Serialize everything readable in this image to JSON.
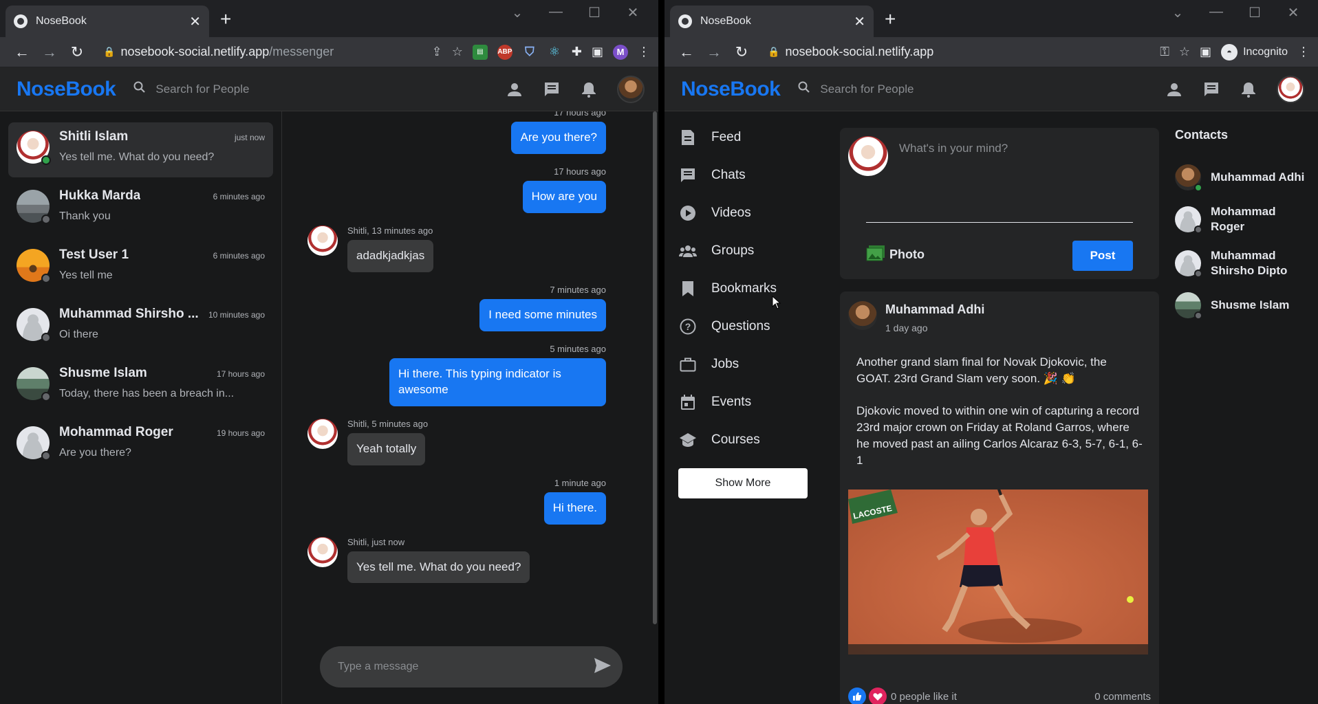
{
  "left_window": {
    "tab_title": "NoseBook",
    "url_host": "nosebook-social.netlify.app",
    "url_path": "/messenger",
    "app": {
      "logo": "NoseBook",
      "search_placeholder": "Search for People"
    },
    "conversations": [
      {
        "name": "Shitli Islam",
        "time": "just now",
        "last": "Yes tell me. What do you need?",
        "online": true,
        "active": true,
        "avatar": "hijab-portrait"
      },
      {
        "name": "Hukka Marda",
        "time": "6 minutes ago",
        "last": "Thank you",
        "online": false,
        "active": false,
        "avatar": "building-photo"
      },
      {
        "name": "Test User 1",
        "time": "6 minutes ago",
        "last": "Yes tell me",
        "online": false,
        "active": false,
        "avatar": "desert-camel"
      },
      {
        "name": "Muhammad Shirsho ...",
        "time": "10 minutes ago",
        "last": "Oi there",
        "online": false,
        "active": false,
        "avatar": "default-user"
      },
      {
        "name": "Shusme Islam",
        "time": "17 hours ago",
        "last": "Today, there has been a breach in...",
        "online": false,
        "active": false,
        "avatar": "landscape-photo"
      },
      {
        "name": "Mohammad Roger",
        "time": "19 hours ago",
        "last": "Are you there?",
        "online": false,
        "active": false,
        "avatar": "default-user"
      }
    ],
    "messages": [
      {
        "mine": true,
        "meta": "17 hours ago",
        "text": "Are you there?"
      },
      {
        "mine": true,
        "meta": "17 hours ago",
        "text": "How are you"
      },
      {
        "mine": false,
        "meta": "Shitli, 13 minutes ago",
        "text": "adadkjadkjas"
      },
      {
        "mine": true,
        "meta": "7 minutes ago",
        "text": "I need some minutes"
      },
      {
        "mine": true,
        "meta": "5 minutes ago",
        "text": "Hi there. This typing indicator is awesome"
      },
      {
        "mine": false,
        "meta": "Shitli, 5 minutes ago",
        "text": "Yeah totally"
      },
      {
        "mine": true,
        "meta": "1 minute ago",
        "text": "Hi there."
      },
      {
        "mine": false,
        "meta": "Shitli, just now",
        "text": "Yes tell me. What do you need?"
      }
    ],
    "composer_placeholder": "Type a message"
  },
  "right_window": {
    "tab_title": "NoseBook",
    "url": "nosebook-social.netlify.app",
    "incognito_label": "Incognito",
    "app": {
      "logo": "NoseBook",
      "search_placeholder": "Search for People"
    },
    "nav": [
      {
        "label": "Feed",
        "icon": "feed-icon"
      },
      {
        "label": "Chats",
        "icon": "chat-icon"
      },
      {
        "label": "Videos",
        "icon": "play-icon"
      },
      {
        "label": "Groups",
        "icon": "groups-icon"
      },
      {
        "label": "Bookmarks",
        "icon": "bookmark-icon"
      },
      {
        "label": "Questions",
        "icon": "question-icon"
      },
      {
        "label": "Jobs",
        "icon": "briefcase-icon"
      },
      {
        "label": "Events",
        "icon": "calendar-icon"
      },
      {
        "label": "Courses",
        "icon": "school-icon"
      }
    ],
    "show_more": "Show More",
    "share": {
      "placeholder": "What's in your mind?",
      "photo_label": "Photo",
      "post_label": "Post"
    },
    "post": {
      "author": "Muhammad Adhi",
      "time": "1 day ago",
      "text": "Another grand slam final for Novak Djokovic, the GOAT. 23rd Grand Slam very soon. 🎉 👏\n\nDjokovic moved to within one win of capturing a record 23rd major crown on Friday at Roland Garros, where he moved past an ailing Carlos Alcaraz 6-3, 5-7, 6-1, 6-1",
      "image_sign": "LACOSTE",
      "likes": "0 people like it",
      "comments": "0 comments"
    },
    "contacts_title": "Contacts",
    "contacts": [
      {
        "name": "Muhammad Adhi",
        "online": true
      },
      {
        "name": "Mohammad Roger",
        "online": false
      },
      {
        "name": "Muhammad Shirsho Dipto",
        "online": false
      },
      {
        "name": "Shusme Islam",
        "online": false
      }
    ]
  },
  "colors": {
    "brand": "#1877f2",
    "bg": "#18191a",
    "surface": "#242526",
    "online": "#31a24c"
  }
}
